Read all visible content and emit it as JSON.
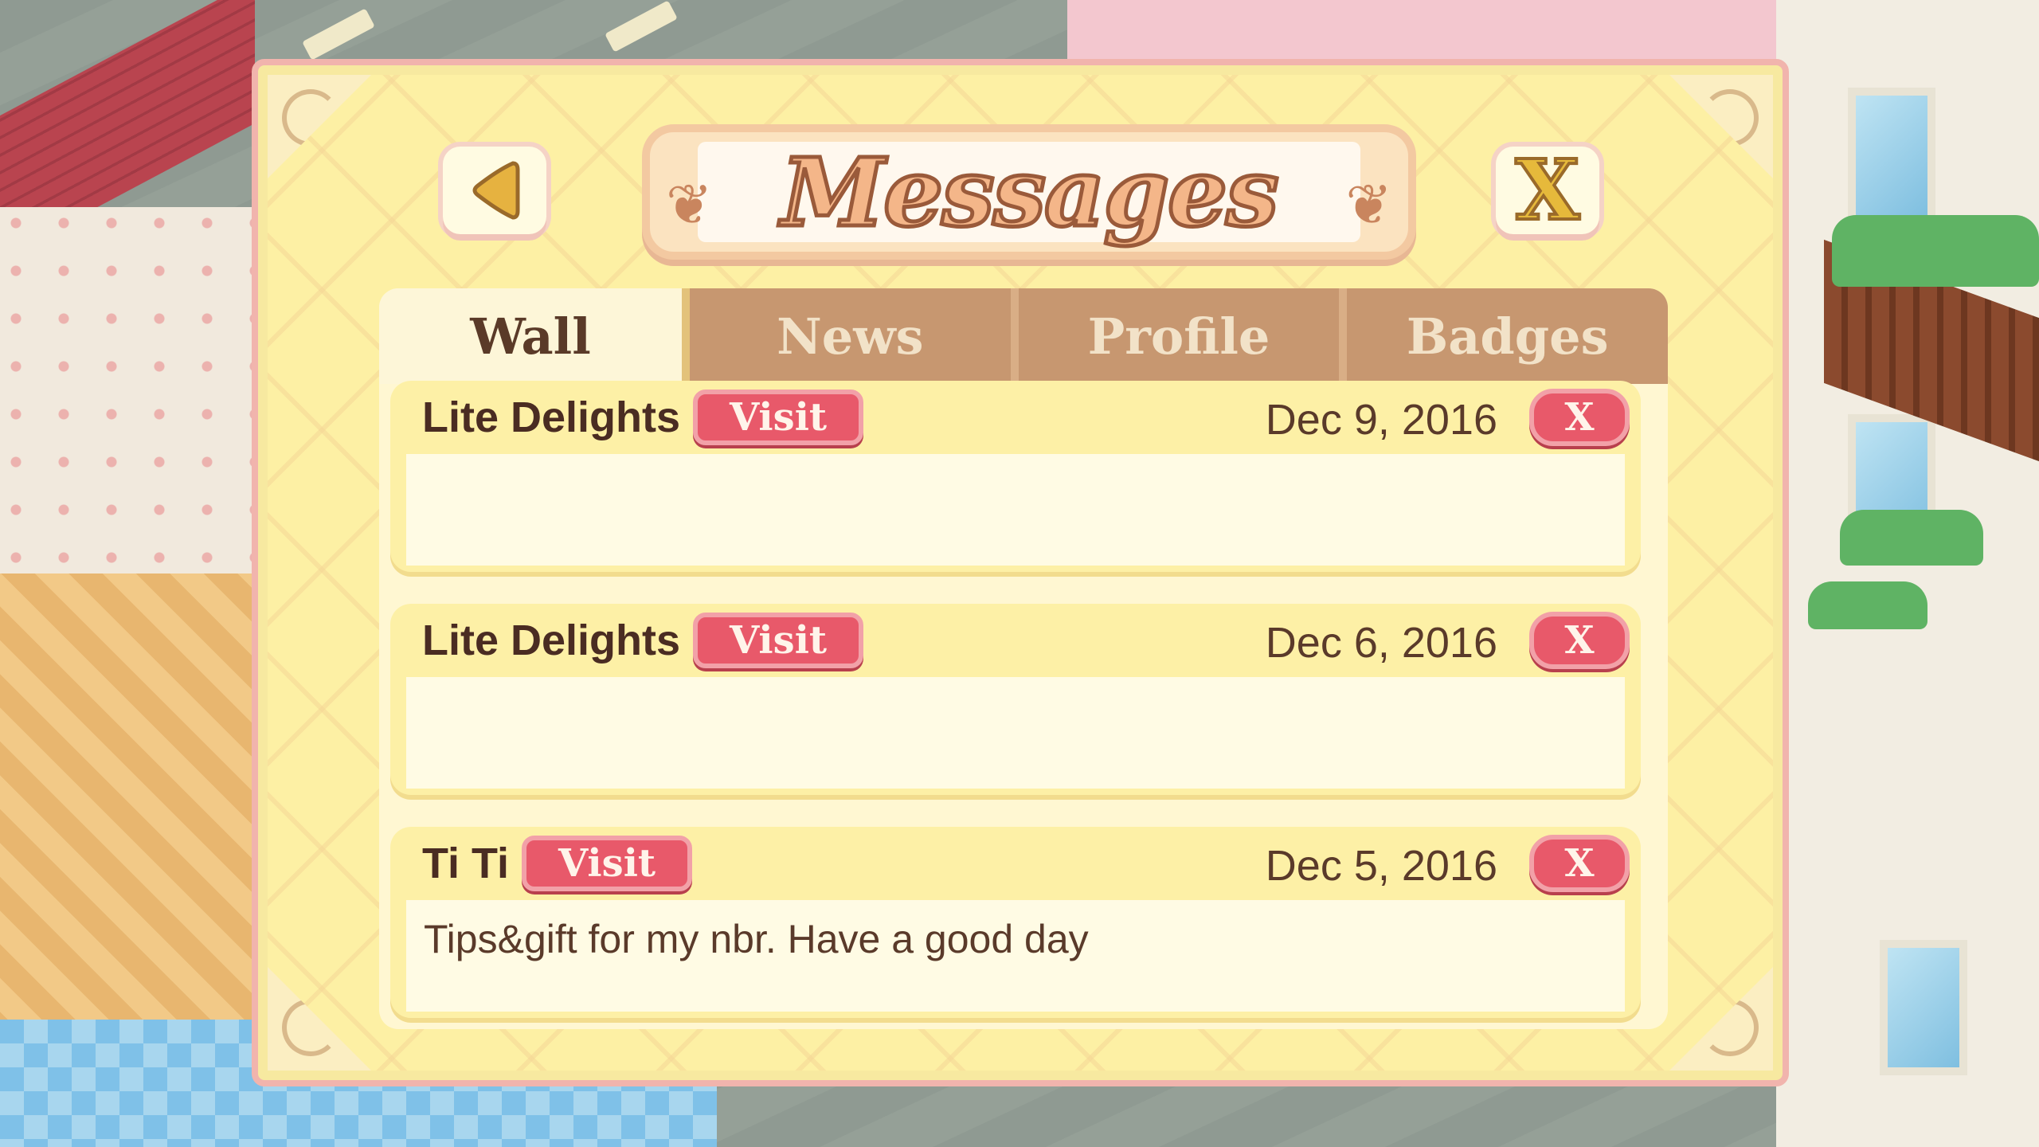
{
  "dialog": {
    "title": "Messages",
    "back_icon": "back-arrow-icon",
    "close_label": "X"
  },
  "tabs": [
    {
      "label": "Wall",
      "active": true
    },
    {
      "label": "News",
      "active": false
    },
    {
      "label": "Profile",
      "active": false
    },
    {
      "label": "Badges",
      "active": false
    }
  ],
  "messages": [
    {
      "sender": "Lite Delights",
      "visit_label": "Visit",
      "date": "Dec 9, 2016",
      "delete_label": "X",
      "body": ""
    },
    {
      "sender": "Lite Delights",
      "visit_label": "Visit",
      "date": "Dec 6, 2016",
      "delete_label": "X",
      "body": ""
    },
    {
      "sender": "Ti Ti",
      "visit_label": "Visit",
      "date": "Dec 5, 2016",
      "delete_label": "X",
      "body": "Tips&gift for my nbr. Have a good day"
    }
  ],
  "colors": {
    "panel": "#fdf0a4",
    "tab_inactive": "#c79770",
    "button_red": "#e8596a",
    "title_fill": "#f4b689"
  }
}
